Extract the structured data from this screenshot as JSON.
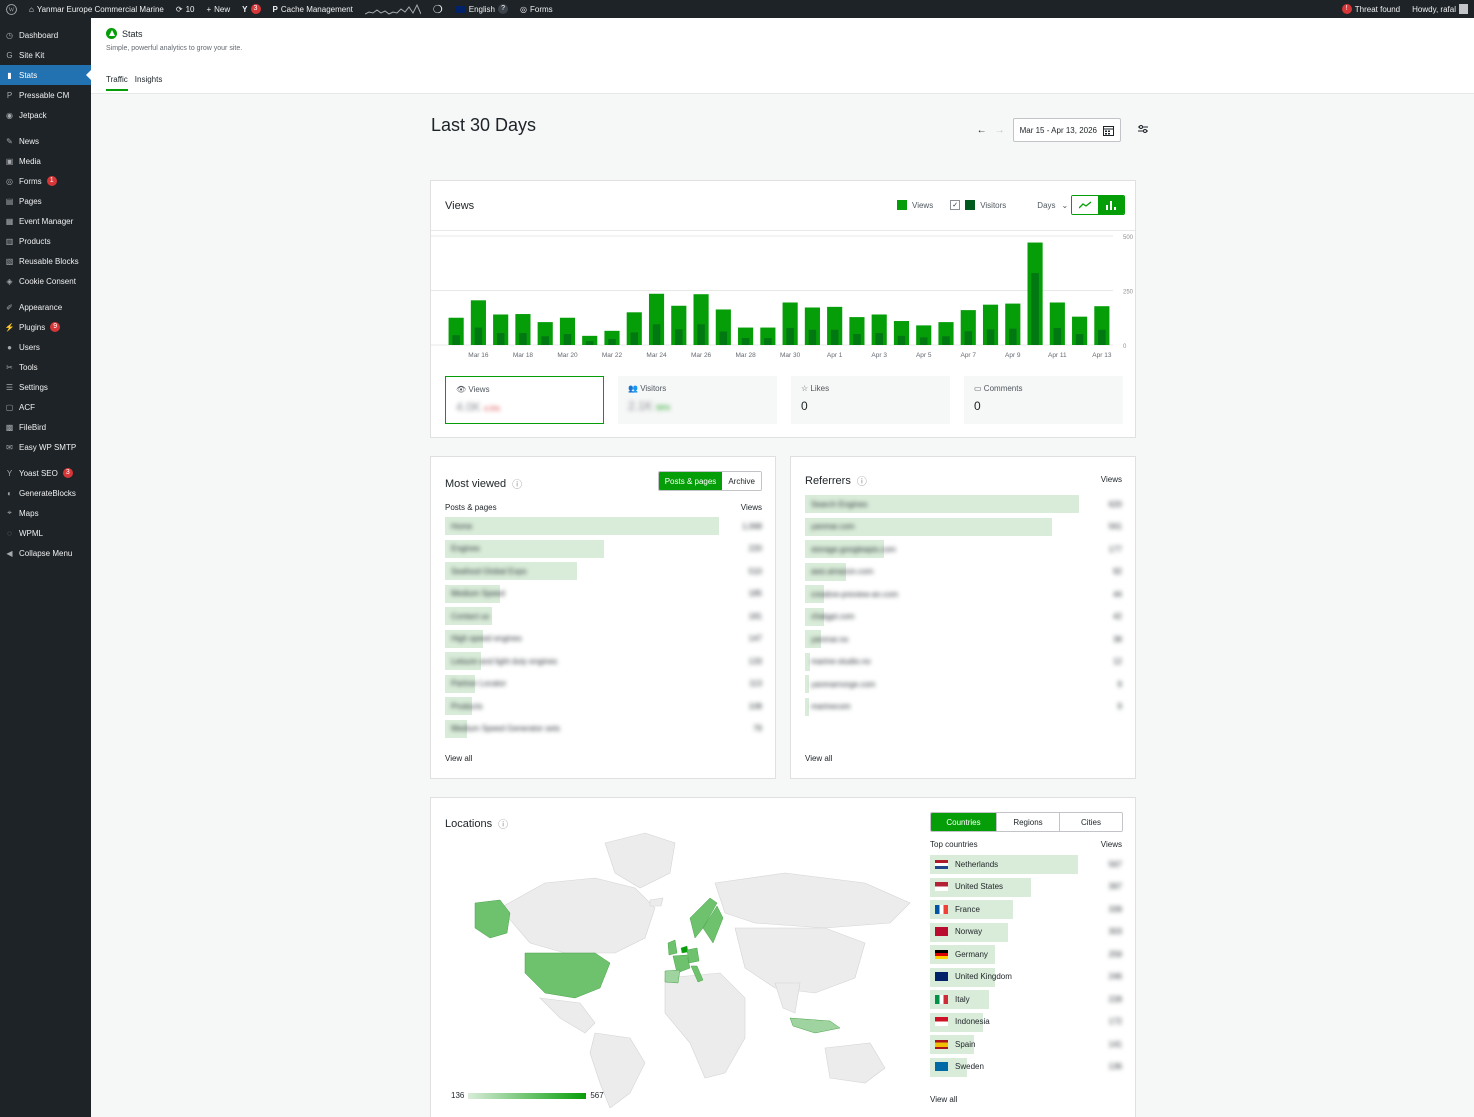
{
  "adminbar": {
    "site_name": "Yanmar Europe Commercial Marine",
    "updates_count": "10",
    "new_label": "New",
    "yoast_count": "3",
    "cache_label": "Cache Management",
    "language": "English",
    "forms_label": "Forms",
    "threat_label": "Threat found",
    "howdy": "Howdy, rafal"
  },
  "sidebar": {
    "items": [
      {
        "label": "Dashboard",
        "icon": "dashboard-icon"
      },
      {
        "label": "Site Kit",
        "icon": "sitekit-icon"
      },
      {
        "label": "Stats",
        "icon": "stats-icon",
        "active": true
      },
      {
        "label": "Pressable CM",
        "icon": "pressable-icon"
      },
      {
        "label": "Jetpack",
        "icon": "jetpack-icon"
      },
      {
        "label": "News",
        "icon": "pin-icon"
      },
      {
        "label": "Media",
        "icon": "media-icon"
      },
      {
        "label": "Forms",
        "icon": "forms-icon",
        "badge": "1"
      },
      {
        "label": "Pages",
        "icon": "pages-icon"
      },
      {
        "label": "Event Manager",
        "icon": "calendar-icon"
      },
      {
        "label": "Products",
        "icon": "products-icon"
      },
      {
        "label": "Reusable Blocks",
        "icon": "blocks-icon"
      },
      {
        "label": "Cookie Consent",
        "icon": "shield-icon"
      },
      {
        "label": "Appearance",
        "icon": "brush-icon"
      },
      {
        "label": "Plugins",
        "icon": "plugin-icon",
        "badge": "9"
      },
      {
        "label": "Users",
        "icon": "users-icon"
      },
      {
        "label": "Tools",
        "icon": "wrench-icon"
      },
      {
        "label": "Settings",
        "icon": "settings-icon"
      },
      {
        "label": "ACF",
        "icon": "acf-icon"
      },
      {
        "label": "FileBird",
        "icon": "folder-icon"
      },
      {
        "label": "Easy WP SMTP",
        "icon": "mail-icon"
      },
      {
        "label": "Yoast SEO",
        "icon": "yoast-icon",
        "badge": "3"
      },
      {
        "label": "GenerateBlocks",
        "icon": "generate-icon"
      },
      {
        "label": "Maps",
        "icon": "map-pin-icon"
      },
      {
        "label": "WPML",
        "icon": "wpml-icon"
      },
      {
        "label": "Collapse Menu",
        "icon": "collapse-icon"
      }
    ]
  },
  "header": {
    "title": "Stats",
    "subtitle": "Simple, powerful analytics to grow your site.",
    "tabs": [
      "Traffic",
      "Insights"
    ]
  },
  "content": {
    "page_title": "Last 30 Days",
    "date_range": "Mar 15 - Apr 13, 2026"
  },
  "views_card": {
    "title": "Views",
    "legend_views": "Views",
    "legend_visitors": "Visitors",
    "interval": "Days",
    "views_color": "#069e08",
    "visitors_color": "#005a1e"
  },
  "chart_data": {
    "type": "bar",
    "categories": [
      "Mar 15",
      "Mar 16",
      "Mar 17",
      "Mar 18",
      "Mar 19",
      "Mar 20",
      "Mar 21",
      "Mar 22",
      "Mar 23",
      "Mar 24",
      "Mar 25",
      "Mar 26",
      "Mar 27",
      "Mar 28",
      "Mar 29",
      "Mar 30",
      "Mar 31",
      "Apr 1",
      "Apr 2",
      "Apr 3",
      "Apr 4",
      "Apr 5",
      "Apr 6",
      "Apr 7",
      "Apr 8",
      "Apr 9",
      "Apr 10",
      "Apr 11",
      "Apr 12",
      "Apr 13"
    ],
    "x_tick_labels": [
      "Mar 16",
      "Mar 18",
      "Mar 20",
      "Mar 22",
      "Mar 24",
      "Mar 26",
      "Mar 28",
      "Mar 30",
      "Apr 1",
      "Apr 3",
      "Apr 5",
      "Apr 7",
      "Apr 9",
      "Apr 11",
      "Apr 13"
    ],
    "series": [
      {
        "name": "Views",
        "values": [
          125,
          205,
          140,
          142,
          105,
          125,
          42,
          65,
          150,
          235,
          180,
          233,
          163,
          80,
          80,
          195,
          172,
          175,
          128,
          140,
          110,
          90,
          105,
          160,
          185,
          190,
          470,
          195,
          130,
          178
        ]
      },
      {
        "name": "Visitors",
        "values": [
          45,
          80,
          55,
          55,
          40,
          50,
          18,
          28,
          58,
          95,
          72,
          95,
          62,
          32,
          32,
          78,
          70,
          70,
          50,
          55,
          42,
          35,
          40,
          63,
          72,
          75,
          330,
          78,
          50,
          70
        ]
      }
    ],
    "ylim": [
      0,
      500
    ],
    "y_ticks": [
      0,
      250,
      500
    ]
  },
  "metrics": [
    {
      "label": "Views",
      "value": "4.0K",
      "change": "4.5%",
      "icon": "eye-icon"
    },
    {
      "label": "Visitors",
      "value": "2.1K",
      "change": "56%",
      "icon": "people-icon"
    },
    {
      "label": "Likes",
      "value": "0",
      "icon": "star-icon"
    },
    {
      "label": "Comments",
      "value": "0",
      "icon": "comment-icon"
    }
  ],
  "most_viewed": {
    "title": "Most viewed",
    "toggle": [
      "Posts & pages",
      "Archive"
    ],
    "col_left": "Posts & pages",
    "col_right": "Views",
    "rows": [
      {
        "label": "Home",
        "value": "1,068",
        "pct": 1.0
      },
      {
        "label": "Engines",
        "value": "220",
        "pct": 0.58
      },
      {
        "label": "Seafood Global Expo",
        "value": "510",
        "pct": 0.48
      },
      {
        "label": "Medium Speed",
        "value": "185",
        "pct": 0.2
      },
      {
        "label": "Contact us",
        "value": "181",
        "pct": 0.17
      },
      {
        "label": "High speed engines",
        "value": "147",
        "pct": 0.14
      },
      {
        "label": "Leisure and light duty engines",
        "value": "133",
        "pct": 0.13
      },
      {
        "label": "Partner Locator",
        "value": "113",
        "pct": 0.11
      },
      {
        "label": "Products",
        "value": "108",
        "pct": 0.1
      },
      {
        "label": "Medium Speed Generator sets",
        "value": "79",
        "pct": 0.08
      }
    ],
    "view_all": "View all"
  },
  "referrers": {
    "title": "Referrers",
    "col_right": "Views",
    "rows": [
      {
        "label": "Search Engines",
        "value": "620",
        "pct": 1.0
      },
      {
        "label": "yanmar.com",
        "value": "561",
        "pct": 0.9
      },
      {
        "label": "storage.googleapis.com",
        "value": "177",
        "pct": 0.29
      },
      {
        "label": "aws.amazon.com",
        "value": "92",
        "pct": 0.15
      },
      {
        "label": "creative-preview-an.com",
        "value": "44",
        "pct": 0.07
      },
      {
        "label": "chatgpt.com",
        "value": "42",
        "pct": 0.07
      },
      {
        "label": "yanmar.no",
        "value": "38",
        "pct": 0.06
      },
      {
        "label": "marine-studio.no",
        "value": "12",
        "pct": 0.02
      },
      {
        "label": "yanmarnorge.com",
        "value": "9",
        "pct": 0.015
      },
      {
        "label": "marinecom",
        "value": "9",
        "pct": 0.015
      }
    ],
    "view_all": "View all"
  },
  "locations": {
    "title": "Locations",
    "tabs": [
      "Countries",
      "Regions",
      "Cities"
    ],
    "col_left": "Top countries",
    "col_right": "Views",
    "legend_min": "136",
    "legend_max": "567",
    "rows": [
      {
        "label": "Netherlands",
        "value": "567",
        "pct": 1.0,
        "flag": "nl"
      },
      {
        "label": "United States",
        "value": "397",
        "pct": 0.68,
        "flag": "us"
      },
      {
        "label": "France",
        "value": "339",
        "pct": 0.56,
        "flag": "fr"
      },
      {
        "label": "Norway",
        "value": "303",
        "pct": 0.53,
        "flag": "no"
      },
      {
        "label": "Germany",
        "value": "259",
        "pct": 0.44,
        "flag": "de"
      },
      {
        "label": "United Kingdom",
        "value": "246",
        "pct": 0.44,
        "flag": "gb"
      },
      {
        "label": "Italy",
        "value": "228",
        "pct": 0.4,
        "flag": "it"
      },
      {
        "label": "Indonesia",
        "value": "172",
        "pct": 0.36,
        "flag": "id"
      },
      {
        "label": "Spain",
        "value": "141",
        "pct": 0.3,
        "flag": "es"
      },
      {
        "label": "Sweden",
        "value": "136",
        "pct": 0.25,
        "flag": "se"
      }
    ],
    "view_all": "View all"
  }
}
